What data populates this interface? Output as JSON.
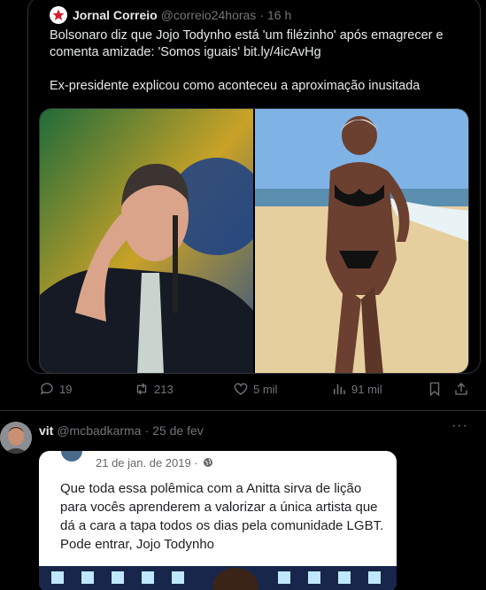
{
  "quoted_post": {
    "author_name": "Jornal Correio",
    "author_handle": "@correio24horas",
    "time": "16 h",
    "text_line1": "Bolsonaro diz que Jojo Todynho está 'um filézinho' após emagrecer e",
    "text_line2": "comenta amizade: 'Somos iguais' bit.ly/4icAvHg",
    "text_line3": "Ex-presidente explicou como aconteceu a aproximação inusitada"
  },
  "actions": {
    "replies": "19",
    "reposts": "213",
    "likes": "5 mil",
    "views": "91 mil"
  },
  "reply_post": {
    "author_name": "vit",
    "author_handle": "@mcbadkarma",
    "time": "25 de fev",
    "embedded_date": "21 de jan. de 2019 ·",
    "embedded_text": "Que toda essa polêmica com a Anitta sirva de lição para vocês aprenderem a valorizar a única artista que dá a cara a tapa todos os dias pela comunidade LGBT. Pode entrar, Jojo Todynho"
  },
  "colors": {
    "background": "#000000",
    "text": "#e7e9ea",
    "muted": "#71767b",
    "border": "#2f3336"
  }
}
